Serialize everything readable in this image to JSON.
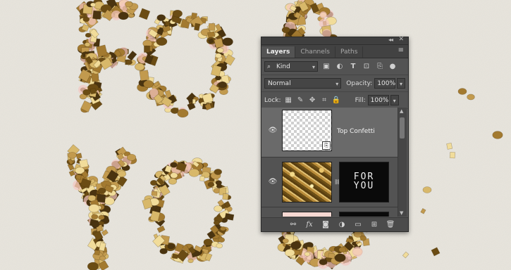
{
  "canvas": {
    "lettering": [
      "F",
      "O",
      "R",
      "Y",
      "O",
      "U"
    ],
    "background_color": "#e7e4dc",
    "confetti_color": "#8a6a2a",
    "blush_color": "#f3c6c0"
  },
  "panel": {
    "collapse_icon": "double-chevron-icon",
    "close_icon": "close-icon",
    "tabs": [
      {
        "label": "Layers",
        "active": true
      },
      {
        "label": "Channels",
        "active": false
      },
      {
        "label": "Paths",
        "active": false
      }
    ],
    "panel_menu_icon": "hamburger-icon",
    "filter": {
      "kind_label": "Kind",
      "icons": [
        "image-filter-icon",
        "adjustment-filter-icon",
        "type-filter-icon",
        "shape-filter-icon",
        "smart-object-filter-icon",
        "filter-toggle-icon"
      ]
    },
    "blend_mode": "Normal",
    "opacity_label": "Opacity:",
    "opacity_value": "100%",
    "lock_label": "Lock:",
    "lock_icons": [
      "lock-transparent-pixels-icon",
      "lock-image-pixels-icon",
      "lock-position-icon",
      "lock-artboard-icon",
      "lock-all-icon"
    ],
    "fill_label": "Fill:",
    "fill_value": "100%",
    "layers": [
      {
        "name": "Top Confetti",
        "visible": true,
        "selected": true
      },
      {
        "name": "",
        "visible": true,
        "selected": false,
        "mask_text": [
          "FOR",
          "YOU"
        ]
      },
      {
        "name": "",
        "visible": false,
        "selected": false
      }
    ],
    "bottom_icons": [
      "link-layers-icon",
      "fx-icon",
      "add-mask-icon",
      "adjustment-layer-icon",
      "new-group-icon",
      "new-layer-icon",
      "delete-layer-icon"
    ],
    "fx_glyph": "fx"
  }
}
